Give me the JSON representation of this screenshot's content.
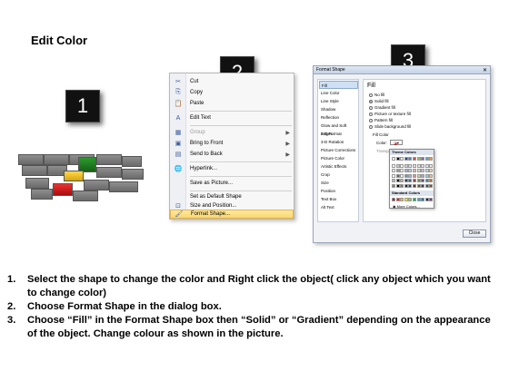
{
  "title": "Edit Color",
  "badges": [
    "1",
    "2",
    "3"
  ],
  "context_menu": {
    "items": [
      {
        "icon": "✂",
        "label": "Cut",
        "disabled": false
      },
      {
        "icon": "⎘",
        "label": "Copy",
        "disabled": false
      },
      {
        "icon": "📋",
        "label": "Paste",
        "disabled": false
      },
      {
        "icon": "A",
        "label": "Edit Text",
        "disabled": false
      },
      {
        "icon": "▦",
        "label": "Group",
        "disabled": true,
        "submenu": true
      },
      {
        "icon": "▣",
        "label": "Bring to Front",
        "disabled": false,
        "submenu": true
      },
      {
        "icon": "▤",
        "label": "Send to Back",
        "disabled": false,
        "submenu": true
      },
      {
        "icon": "🌐",
        "label": "Hyperlink...",
        "disabled": false
      },
      {
        "icon": "",
        "label": "Save as Picture...",
        "disabled": false
      },
      {
        "icon": "",
        "label": "Set as Default Shape",
        "disabled": false
      },
      {
        "icon": "⊡",
        "label": "Size and Position...",
        "disabled": false
      },
      {
        "icon": "🖌",
        "label": "Format Shape...",
        "disabled": false,
        "highlighted": true
      }
    ]
  },
  "format_dialog": {
    "title": "Format Shape",
    "nav": [
      "Fill",
      "Line Color",
      "Line Style",
      "Shadow",
      "Reflection",
      "Glow and Soft Edges",
      "3-D Format",
      "3-D Rotation",
      "Picture Corrections",
      "Picture Color",
      "Artistic Effects",
      "Crop",
      "Size",
      "Position",
      "Text Box",
      "Alt Text"
    ],
    "selected_nav": "Fill",
    "pane_heading": "Fill",
    "options": [
      "No fill",
      "Solid fill",
      "Gradient fill",
      "Picture or texture fill",
      "Pattern fill",
      "Slide background fill"
    ],
    "selected_option": "Solid fill",
    "fill_color_label": "Fill Color",
    "color_label": "Color:",
    "transparency_label": "Transparency:",
    "palette_theme_label": "Theme Colors",
    "palette_standard_label": "Standard Colors",
    "more_colors_label": "More Colors...",
    "close_label": "Close"
  },
  "palette_colors": {
    "theme_top": [
      "#ffffff",
      "#000000",
      "#eeece1",
      "#1f497d",
      "#4f81bd",
      "#c0504d",
      "#9bbb59",
      "#8064a2",
      "#4bacc6",
      "#f79646"
    ],
    "standard": [
      "#c00000",
      "#ff0000",
      "#ffc000",
      "#ffff00",
      "#92d050",
      "#00b050",
      "#00b0f0",
      "#0070c0",
      "#002060",
      "#7030a0"
    ]
  },
  "instructions": [
    {
      "num": "1.",
      "text": "Select the shape to change the color and Right click the object( click any object which you want to change color)"
    },
    {
      "num": "2.",
      "text": "Choose Format Shape in the dialog box."
    },
    {
      "num": "3.",
      "text": "Choose “Fill” in the Format Shape box then “Solid” or “Gradient” depending on the appearance of the object. Change colour as shown in the picture."
    }
  ],
  "colors": {
    "brick_gray": "#7a7a7a",
    "brick_green": "#1e7a1e",
    "brick_yellow": "#f2c01e",
    "brick_red": "#d01818",
    "menu_highlight": "#fbd66a"
  }
}
